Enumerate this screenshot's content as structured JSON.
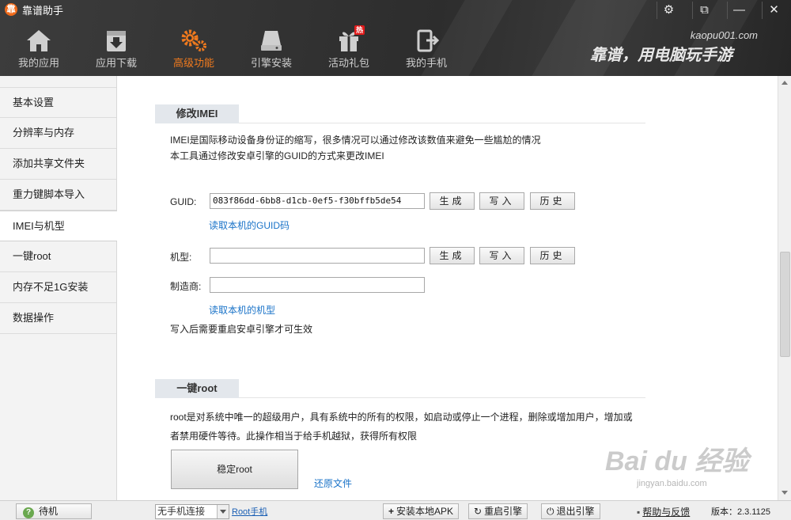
{
  "app": {
    "title": "靠谱助手",
    "logo_char": "靠"
  },
  "window_controls": [
    "⚙",
    "⧉",
    "—",
    "✕"
  ],
  "nav": [
    {
      "label": "我的应用",
      "icon": "home-icon"
    },
    {
      "label": "应用下载",
      "icon": "download-icon"
    },
    {
      "label": "高级功能",
      "icon": "gears-icon",
      "active": true
    },
    {
      "label": "引擎安装",
      "icon": "drive-icon"
    },
    {
      "label": "活动礼包",
      "icon": "gift-icon",
      "badge": "热"
    },
    {
      "label": "我的手机",
      "icon": "phone-exit-icon"
    }
  ],
  "brand": {
    "url": "kaopu001.com",
    "slogan": "靠谱，用电脑玩手游"
  },
  "sidebar": [
    "基本设置",
    "分辨率与内存",
    "添加共享文件夹",
    "重力键脚本导入",
    "IMEI与机型",
    "一键root",
    "内存不足1G安装",
    "数据操作"
  ],
  "sidebar_active": "IMEI与机型",
  "imei": {
    "section_title": "修改IMEI",
    "desc1": "IMEI是国际移动设备身份证的缩写，很多情况可以通过修改该数值来避免一些尴尬的情况",
    "desc2": "本工具通过修改安卓引擎的GUID的方式来更改IMEI",
    "guid_label": "GUID:",
    "guid_value": "083f86dd-6bb8-d1cb-0ef5-f30bffb5de54",
    "btn_generate": "生成",
    "btn_write": "写入",
    "btn_history": "历史",
    "read_guid_link": "读取本机的GUID码",
    "model_label": "机型:",
    "model_value": "",
    "maker_label": "制造商:",
    "maker_value": "",
    "read_model_link": "读取本机的机型",
    "note": "写入后需要重启安卓引擎才可生效"
  },
  "root": {
    "section_title": "一键root",
    "desc1": "root是对系统中唯一的超级用户，具有系统中的所有的权限，如启动或停止一个进程，删除或增加用户，增加或",
    "desc2": "者禁用硬件等待。此操作相当于给手机越狱，获得所有权限",
    "btn_root": "稳定root",
    "restore_link": "还原文件"
  },
  "status": {
    "standby": "待机",
    "phone_select": "无手机连接",
    "root_phone": "Root手机",
    "install_apk": "安装本地APK",
    "restart_engine": "重启引擎",
    "exit_engine": "退出引擎",
    "help": "帮助与反馈",
    "version": "版本：2.3.1125"
  },
  "watermark": {
    "text": "Bai du 经验",
    "sub": "jingyan.baidu.com"
  },
  "colors": {
    "accent": "#f07a1e",
    "link": "#1a73c8",
    "titlebar": "#2f2f2f"
  }
}
